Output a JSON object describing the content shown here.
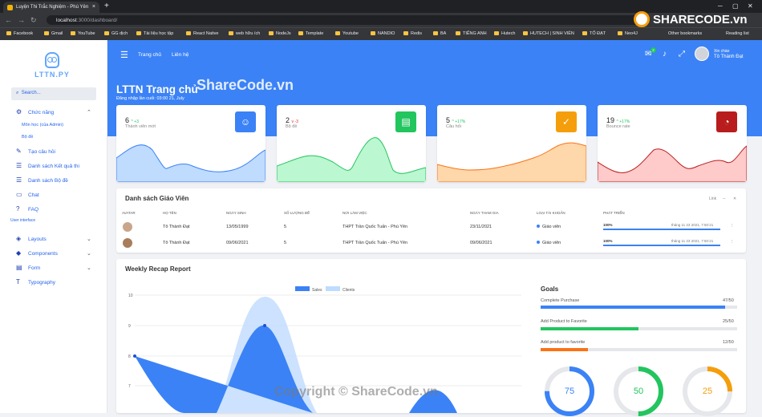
{
  "browser": {
    "tab_title": "Luyện Thi Trắc Nghiệm - Phú Yên",
    "url_host": "localhost",
    "url_path": ":3000/dashboard/",
    "bookmarks": [
      "Facebook",
      "Gmail",
      "YouTube",
      "GG dịch",
      "Tài liệu học tập",
      "React Native",
      "web hữu ích",
      "NodeJs",
      "Template",
      "Youtube",
      "NANDIO",
      "Redis",
      "BA",
      "TIẾNG ANH",
      "Hutech",
      "HUTECH | SINH VIÊN",
      "TỐ ĐẠT",
      "Neo4J"
    ],
    "other_bookmarks": "Other bookmarks",
    "reading_list": "Reading list"
  },
  "sidebar": {
    "logo": "LTTN.PY",
    "search_placeholder": "Search...",
    "chuc_nang": "Chức năng",
    "sub1": "Môn học (của Admin)",
    "sub2": "Bộ đề",
    "items": [
      "Tạo câu hỏi",
      "Danh sách Kết quả thi",
      "Danh sách Bộ đề",
      "Chat",
      "FAQ"
    ],
    "section": "User interface",
    "ui_items": [
      "Layouts",
      "Components",
      "Form",
      "Typography"
    ]
  },
  "header": {
    "nav1": "Trang chủ",
    "nav2": "Liên hệ",
    "mail_badge": "2",
    "greeting": "Xin chào",
    "username": "Tô Thành Đạt",
    "title": "LTTN Trang chủ",
    "last_login": "Đăng nhập lần cuối: 03:00 21, July"
  },
  "cards": [
    {
      "value": "6",
      "delta": "^ +3",
      "label": "Thành viên mới",
      "color": "#3b82f6",
      "icon": "user-icon"
    },
    {
      "value": "2",
      "delta": "v -3",
      "label": "Bộ đề",
      "color": "#22c55e",
      "icon": "document-icon"
    },
    {
      "value": "5",
      "delta": "^ +17%",
      "label": "Câu hỏi",
      "color": "#f59e0b",
      "icon": "check-icon"
    },
    {
      "value": "19",
      "delta": "^ +17%",
      "label": "Bounce rate",
      "color": "#dc2626",
      "icon": "pie-icon"
    }
  ],
  "teachers": {
    "title": "Danh sách Giáo Viên",
    "link": "Link",
    "headers": [
      "Avatar",
      "Họ tên",
      "Ngày sinh",
      "Số lượng đề",
      "Nơi làm việc",
      "Ngày tham gia",
      "Loại tài khoản",
      "Phát triển"
    ],
    "rows": [
      {
        "name": "Tô Thành Đạt",
        "dob": "13/05/1999",
        "count": "5",
        "work": "THPT Trần Quốc Tuấn - Phú Yên",
        "joined": "23/11/2021",
        "type": "Giáo viên",
        "progress": "100%",
        "progress_value": 100,
        "time": "tháng 11 23 2021, 7:50:21"
      },
      {
        "name": "Tô Thành Đạt",
        "dob": "09/06/2021",
        "count": "5",
        "work": "THPT Trần Quốc Tuấn - Phú Yên",
        "joined": "09/06/2021",
        "type": "Giáo viên",
        "progress": "100%",
        "progress_value": 100,
        "time": "tháng 11 23 2021, 7:50:21"
      }
    ]
  },
  "weekly": {
    "title": "Weekly Recap Report",
    "goals_title": "Goals",
    "goals": [
      {
        "label": "Complete Purchase",
        "value": "47/50",
        "ratio": 0.94,
        "color": "#3b82f6"
      },
      {
        "label": "Add Product to Favorite",
        "value": "25/50",
        "ratio": 0.5,
        "color": "#22c55e"
      },
      {
        "label": "Add product to favorite",
        "value": "12/50",
        "ratio": 0.24,
        "color": "#f59e0b"
      }
    ],
    "rings": [
      {
        "value": "75",
        "ratio": 0.75,
        "color": "#3b82f6"
      },
      {
        "value": "50",
        "ratio": 0.5,
        "color": "#22c55e"
      },
      {
        "value": "25",
        "ratio": 0.25,
        "color": "#f59e0b"
      }
    ]
  },
  "chart_data": {
    "type": "area",
    "series": [
      {
        "name": "Sales"
      },
      {
        "name": "Clients"
      }
    ],
    "yticks": [
      "10",
      "9",
      "8",
      "7"
    ],
    "ylim": [
      6,
      10
    ],
    "legend": "top-center"
  },
  "watermark": {
    "logo": "SHARECODE.vn",
    "center": "ShareCode.vn",
    "bottom": "Copyright © ShareCode.vn"
  }
}
